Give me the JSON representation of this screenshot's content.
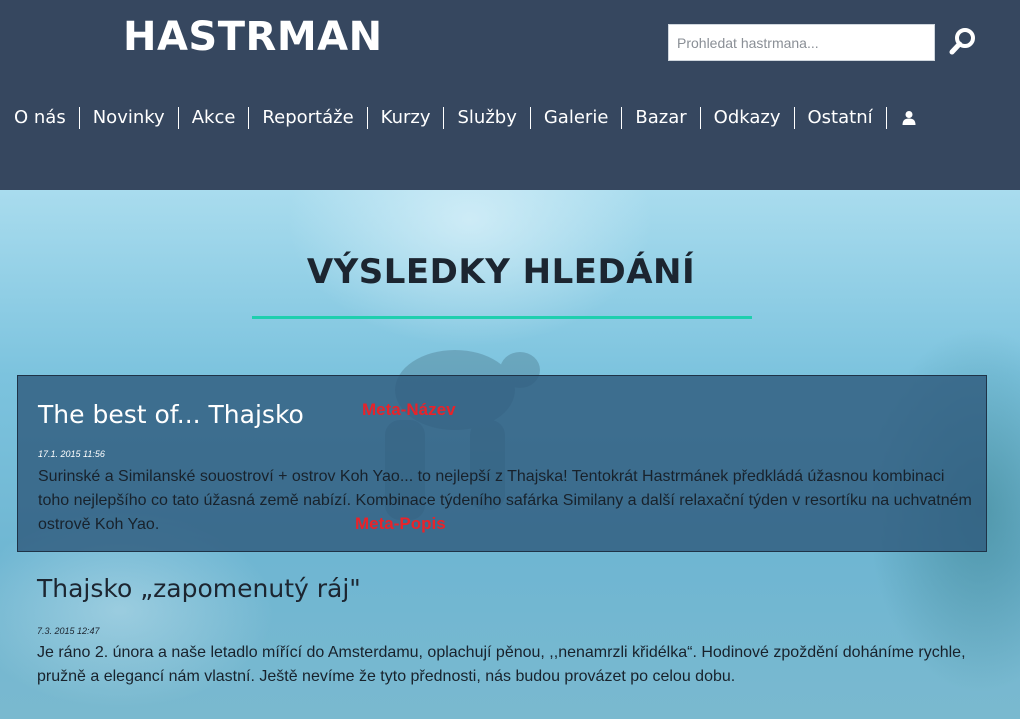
{
  "header": {
    "logo": "HASTRMAN",
    "search": {
      "placeholder": "Prohledat hastrmana...",
      "value": ""
    },
    "icons": {
      "search": "search-icon",
      "user": "user-icon"
    }
  },
  "nav": {
    "items": [
      {
        "label": "O nás"
      },
      {
        "label": "Novinky"
      },
      {
        "label": "Akce"
      },
      {
        "label": "Reportáže"
      },
      {
        "label": "Kurzy"
      },
      {
        "label": "Služby"
      },
      {
        "label": "Galerie"
      },
      {
        "label": "Bazar"
      },
      {
        "label": "Odkazy"
      },
      {
        "label": "Ostatní"
      }
    ]
  },
  "main": {
    "title": "VÝSLEDKY HLEDÁNÍ",
    "results": [
      {
        "title": "The best of... Thajsko",
        "date": "17.1. 2015 11:56",
        "description": "Surinské a Similanské souostroví + ostrov Koh Yao... to nejlepší z Thajska! Tentokrát Hastrmánek předkládá úžasnou kombinaci toho nejlepšího co tato úžasná země nabízí. Kombinace týdeního safárka Similany a další relaxační týden v resortíku na uchvatném ostrově Koh Yao."
      },
      {
        "title": "Thajsko „zapomenutý ráj\"",
        "date": "7.3. 2015 12:47",
        "description": "Je ráno 2. února a naše letadlo mířící do Amsterdamu, oplachují pěnou, ,,nenamrzli křidélka“. Hodinové zpoždění doháníme rychle, pružně a elegancí nám vlastní. Ještě nevíme že tyto přednosti, nás budou provázet po celou dobu."
      }
    ]
  },
  "annotations": {
    "name_label": "Meta-Název",
    "description_label": "Meta-Popis"
  },
  "colors": {
    "header_bg": "#36475f",
    "accent_rule": "#1fcfae",
    "highlight_bg": "#305c7e",
    "annotation": "#e8232a"
  }
}
